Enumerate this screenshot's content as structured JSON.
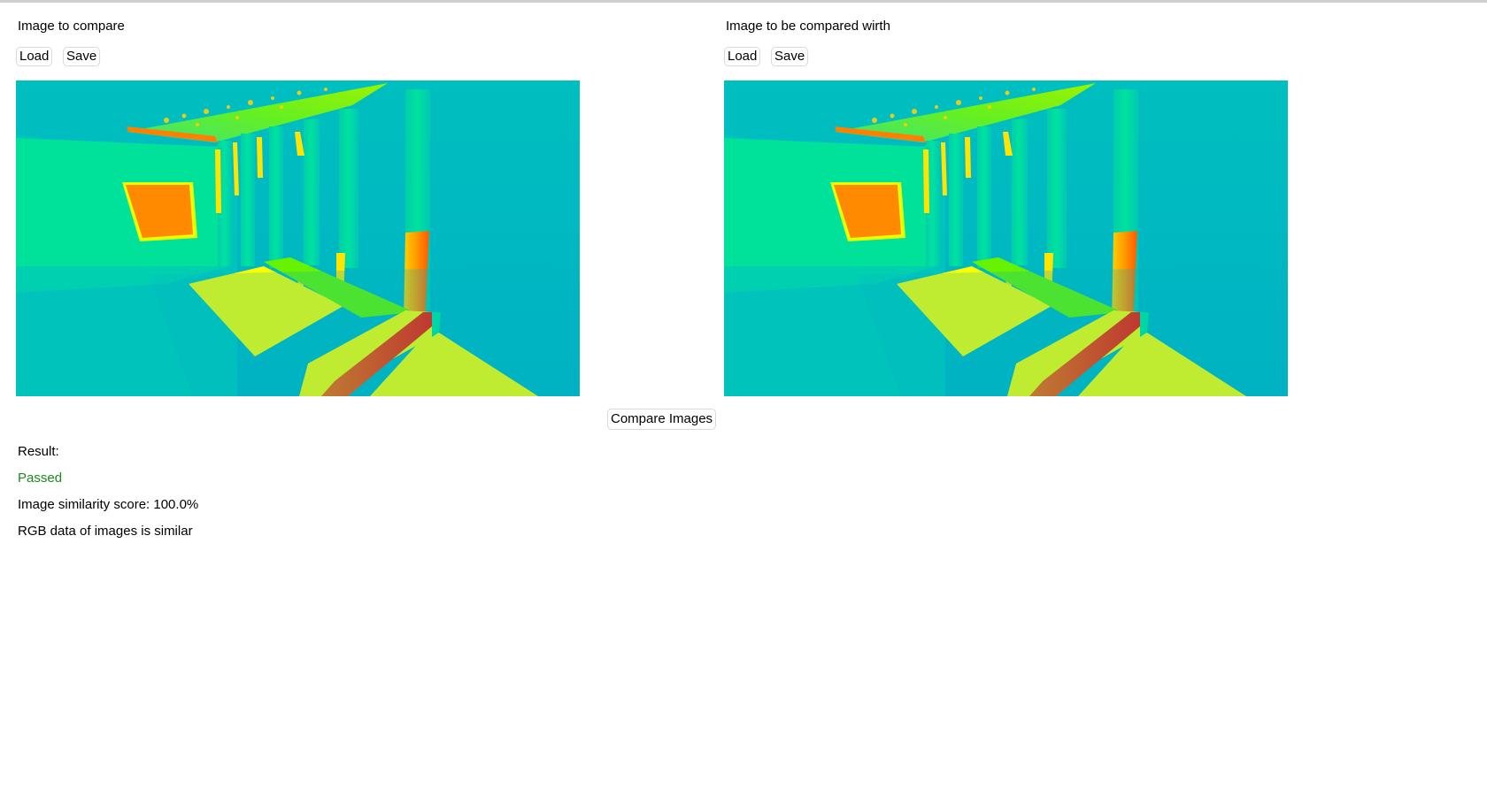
{
  "left_panel": {
    "title": "Image to compare",
    "load_label": "Load",
    "save_label": "Save"
  },
  "right_panel": {
    "title": "Image to be compared wirth",
    "load_label": "Load",
    "save_label": "Save"
  },
  "compare_button_label": "Compare Images",
  "result": {
    "label": "Result:",
    "status": "Passed",
    "score_text": "Image similarity score: 100.0%",
    "rgb_text": "RGB data of images is similar"
  },
  "colors": {
    "passed": "#1a8a1a",
    "heatmap_background": "#00b9bf"
  }
}
